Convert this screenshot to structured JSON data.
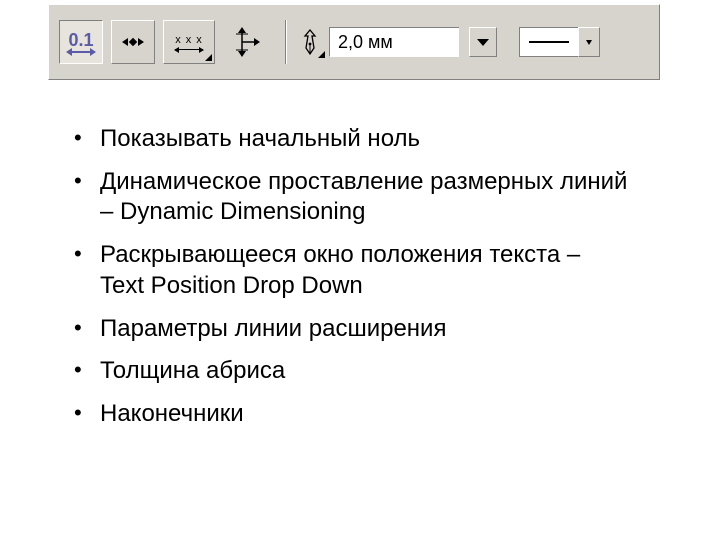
{
  "toolbar": {
    "thickness_value": "2,0 мм"
  },
  "list": {
    "items": [
      "Показывать начальный ноль",
      "Динамическое проставление размерных линий – Dynamic Dimensioning",
      "Раскрывающееся окно положения текста – Text Position Drop Down",
      "Параметры линии расширения",
      "Толщина абриса",
      "Наконечники"
    ]
  }
}
